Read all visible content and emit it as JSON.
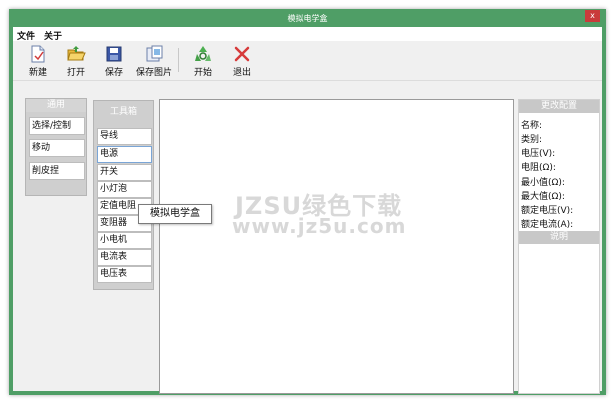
{
  "window": {
    "title": "模拟电学盒",
    "close_label": "x"
  },
  "menu": [
    "文件",
    "关于"
  ],
  "toolbar": {
    "new": "新建",
    "open": "打开",
    "save": "保存",
    "save_image": "保存图片",
    "start": "开始",
    "exit": "退出"
  },
  "general_panel": {
    "title": "通用",
    "buttons": [
      "选择/控制",
      "移动",
      "削皮捏"
    ]
  },
  "toolbox": {
    "title": "工具箱",
    "items": [
      "导线",
      "电源",
      "开关",
      "小灯泡",
      "定值电阻",
      "变阻器",
      "小电机",
      "电流表",
      "电压表"
    ]
  },
  "tooltip": "模拟电学盒",
  "watermark": {
    "line1": "JZSU绿色下载",
    "line2": "www.jz5u.com"
  },
  "config_panel": {
    "title": "更改配置",
    "fields": [
      "名称:",
      "类别:",
      "电压(V):",
      "电阻(Ω):",
      "最小值(Ω):",
      "最大值(Ω):",
      "额定电压(V):",
      "额定电流(A):"
    ],
    "description_title": "说明"
  },
  "colors": {
    "title_bar": "#4f9e66",
    "panel_header": "#c8c8c8",
    "canvas": "#ffffff"
  }
}
